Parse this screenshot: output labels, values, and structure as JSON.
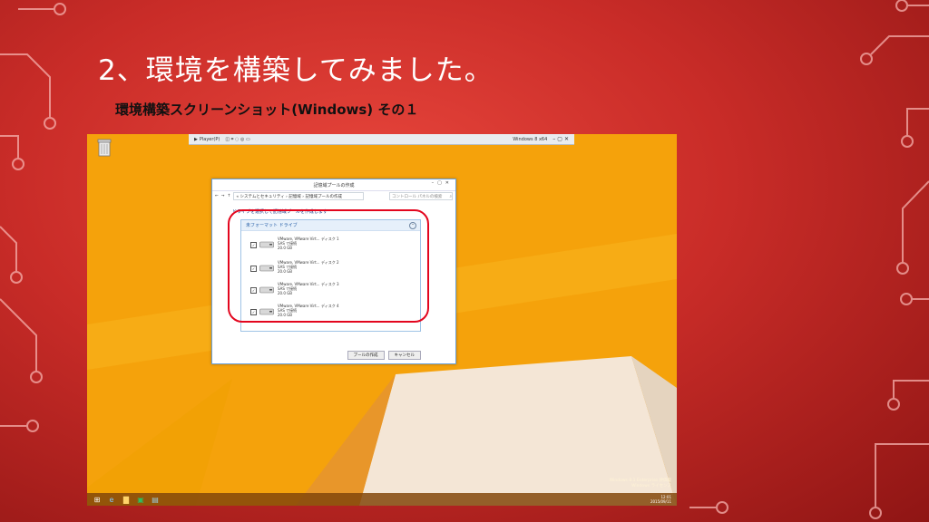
{
  "slide": {
    "title": "2、環境を構築してみました。",
    "subtitle": "環境構築スクリーンショット(Windows) その１"
  },
  "vm_player": {
    "menu_label": "Player(P)",
    "window_title": "Windows 8 x64"
  },
  "dialog": {
    "title": "記憶域プールの作成",
    "breadcrumb": "« システムとセキュリティ › 記憶域 › 記憶域プールの作成",
    "search_placeholder": "コントロール パネルの検索",
    "instruction": "ドライブを選択して記憶域プールを作成します",
    "group_header": "未フォーマット ドライブ",
    "drives": [
      {
        "model": "VMware, VMware Virt...",
        "bus": "SAS で接続",
        "size": "20.0 GB",
        "disk": "ディスク 1",
        "checked": true
      },
      {
        "model": "VMware, VMware Virt...",
        "bus": "SAS で接続",
        "size": "20.0 GB",
        "disk": "ディスク 2",
        "checked": true
      },
      {
        "model": "VMware, VMware Virt...",
        "bus": "SAS で接続",
        "size": "20.0 GB",
        "disk": "ディスク 3",
        "checked": true
      },
      {
        "model": "VMware, VMware Virt...",
        "bus": "SAS で接続",
        "size": "20.0 GB",
        "disk": "ディスク 4",
        "checked": true
      }
    ],
    "create_button": "プールの作成",
    "cancel_button": "キャンセル"
  },
  "desktop": {
    "watermark_line1": "Windows 8.1 Enterprise 評価版",
    "watermark_line2": "Windows ライセンス",
    "clock_time": "12:01",
    "clock_date": "2015/09/11"
  },
  "colors": {
    "slide_bg": "#c92c28",
    "desktop_bg": "#f5a20b",
    "highlight": "#e3061e"
  }
}
